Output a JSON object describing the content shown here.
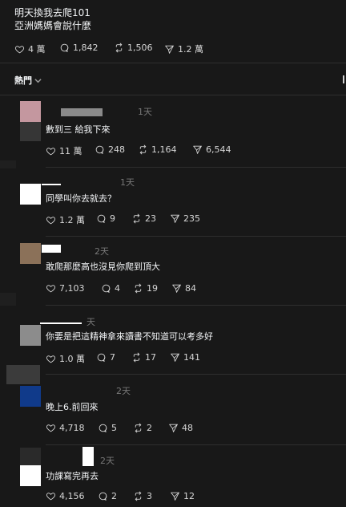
{
  "post": {
    "line1": "明天換我去爬101",
    "line2": "亞洲媽媽會說什麼",
    "stats": {
      "likes": "4 萬",
      "replies": "1,842",
      "reposts": "1,506",
      "shares": "1.2 萬"
    }
  },
  "sort": {
    "label": "熱門"
  },
  "comments": [
    {
      "time": "1天",
      "text": "數到三 給我下來",
      "likes": "11 萬",
      "replies": "248",
      "reposts": "1,164",
      "shares": "6,544"
    },
    {
      "time": "1天",
      "text": "同學叫你去就去？",
      "likes": "1.2 萬",
      "replies": "9",
      "reposts": "23",
      "shares": "235"
    },
    {
      "time": "2天",
      "text": "敢爬那麼高也沒見你爬到頂大",
      "likes": "7,103",
      "replies": "4",
      "reposts": "19",
      "shares": "84"
    },
    {
      "time": "天",
      "text": "你要是把這精神拿來讀書不知道可以考多好",
      "likes": "1.0 萬",
      "replies": "7",
      "reposts": "17",
      "shares": "141"
    },
    {
      "time": "2天",
      "text": "晚上6.前回來",
      "likes": "4,718",
      "replies": "5",
      "reposts": "2",
      "shares": "48"
    },
    {
      "time": "2天",
      "text": "功課寫完再去",
      "likes": "4,156",
      "replies": "2",
      "reposts": "3",
      "shares": "12"
    }
  ],
  "icons": {
    "like": "heart-icon",
    "reply": "comment-icon",
    "repost": "repost-icon",
    "share": "send-icon",
    "sort": "chevron-down-icon"
  },
  "colors": {
    "background": "#181818",
    "text": "#f3f5f7",
    "secondary": "#777777",
    "divider": "#2e2e2e"
  }
}
